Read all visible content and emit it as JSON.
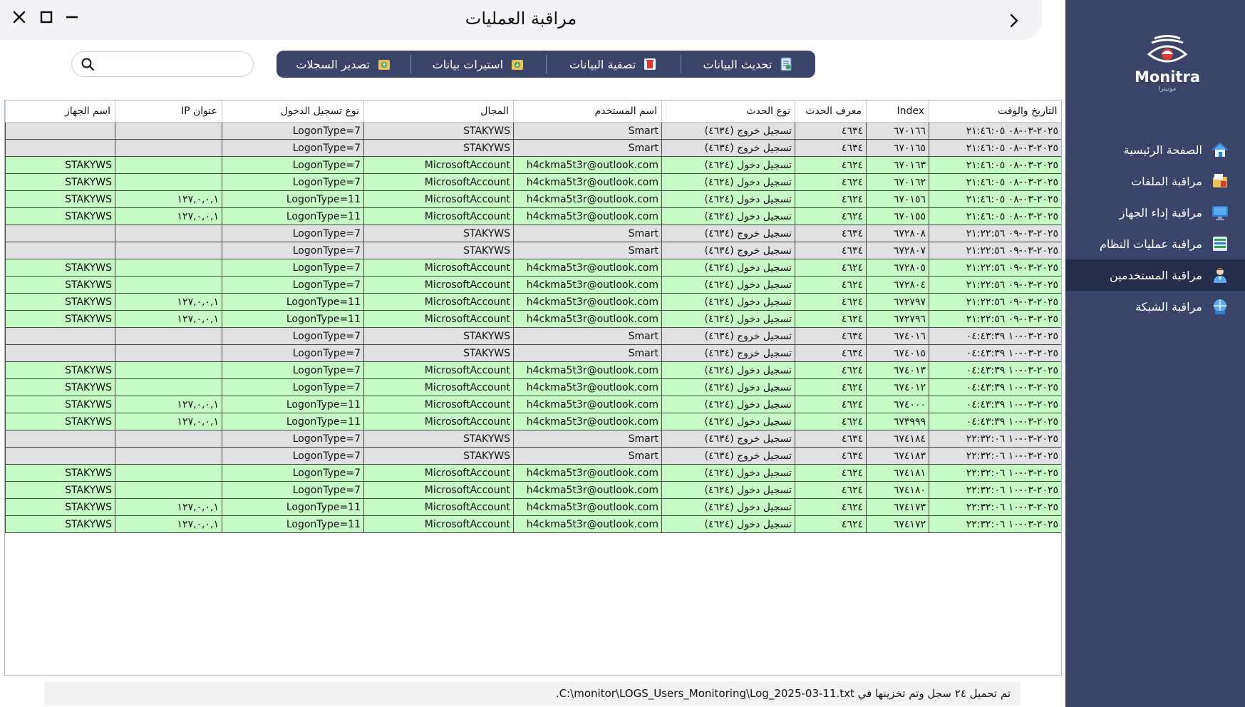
{
  "window": {
    "title": "مراقبة العمليات"
  },
  "search": {
    "placeholder": "",
    "value": ""
  },
  "toolbar": {
    "buttons": [
      {
        "label": "تحديث البيانات",
        "icon": "refresh-doc-icon"
      },
      {
        "label": "تصفية البيانات",
        "icon": "trash-icon"
      },
      {
        "label": "استيرات بيانات",
        "icon": "import-icon"
      },
      {
        "label": "تصدير السجلات",
        "icon": "export-icon"
      }
    ]
  },
  "table": {
    "headers": [
      "التاريخ والوقت",
      "Index",
      "معرف الحدث",
      "نوع الحدث",
      "اسم المستخدم",
      "المجال",
      "نوع تسجيل الدخول",
      "عنوان IP",
      "اسم الجهاز"
    ],
    "rows": [
      [
        "٢٠٢٥-٠٣-٠٨ ٢١:٤٦:٠٥",
        "٦٧٠١٦٦",
        "٤٦٣٤",
        "تسجيل خروج (٤٦٣٤)",
        "Smart",
        "STAKYWS",
        "LogonType=7",
        "",
        ""
      ],
      [
        "٢٠٢٥-٠٣-٠٨ ٢١:٤٦:٠٥",
        "٦٧٠١٦٥",
        "٤٦٣٤",
        "تسجيل خروج (٤٦٣٤)",
        "Smart",
        "STAKYWS",
        "LogonType=7",
        "",
        ""
      ],
      [
        "٢٠٢٥-٠٣-٠٨ ٢١:٤٦:٠٥",
        "٦٧٠١٦٣",
        "٤٦٢٤",
        "تسجيل دخول (٤٦٢٤)",
        "h4ckma5t3r@outlook.com",
        "MicrosoftAccount",
        "LogonType=7",
        "",
        "STAKYWS"
      ],
      [
        "٢٠٢٥-٠٣-٠٨ ٢١:٤٦:٠٥",
        "٦٧٠١٦٢",
        "٤٦٢٤",
        "تسجيل دخول (٤٦٢٤)",
        "h4ckma5t3r@outlook.com",
        "MicrosoftAccount",
        "LogonType=7",
        "",
        "STAKYWS"
      ],
      [
        "٢٠٢٥-٠٣-٠٨ ٢١:٤٦:٠٥",
        "٦٧٠١٥٦",
        "٤٦٢٤",
        "تسجيل دخول (٤٦٢٤)",
        "h4ckma5t3r@outlook.com",
        "MicrosoftAccount",
        "LogonType=11",
        "١٢٧,٠,٠,١",
        "STAKYWS"
      ],
      [
        "٢٠٢٥-٠٣-٠٨ ٢١:٤٦:٠٥",
        "٦٧٠١٥٥",
        "٤٦٢٤",
        "تسجيل دخول (٤٦٢٤)",
        "h4ckma5t3r@outlook.com",
        "MicrosoftAccount",
        "LogonType=11",
        "١٢٧,٠,٠,١",
        "STAKYWS"
      ],
      [
        "٢٠٢٥-٠٣-٠٩ ٢١:٢٢:٥٦",
        "٦٧٢٨٠٨",
        "٤٦٣٤",
        "تسجيل خروج (٤٦٣٤)",
        "Smart",
        "STAKYWS",
        "LogonType=7",
        "",
        ""
      ],
      [
        "٢٠٢٥-٠٣-٠٩ ٢١:٢٢:٥٦",
        "٦٧٢٨٠٧",
        "٤٦٣٤",
        "تسجيل خروج (٤٦٣٤)",
        "Smart",
        "STAKYWS",
        "LogonType=7",
        "",
        ""
      ],
      [
        "٢٠٢٥-٠٣-٠٩ ٢١:٢٢:٥٦",
        "٦٧٢٨٠٥",
        "٤٦٢٤",
        "تسجيل دخول (٤٦٢٤)",
        "h4ckma5t3r@outlook.com",
        "MicrosoftAccount",
        "LogonType=7",
        "",
        "STAKYWS"
      ],
      [
        "٢٠٢٥-٠٣-٠٩ ٢١:٢٢:٥٦",
        "٦٧٢٨٠٤",
        "٤٦٢٤",
        "تسجيل دخول (٤٦٢٤)",
        "h4ckma5t3r@outlook.com",
        "MicrosoftAccount",
        "LogonType=7",
        "",
        "STAKYWS"
      ],
      [
        "٢٠٢٥-٠٣-٠٩ ٢١:٢٢:٥٦",
        "٦٧٢٧٩٧",
        "٤٦٢٤",
        "تسجيل دخول (٤٦٢٤)",
        "h4ckma5t3r@outlook.com",
        "MicrosoftAccount",
        "LogonType=11",
        "١٢٧,٠,٠,١",
        "STAKYWS"
      ],
      [
        "٢٠٢٥-٠٣-٠٩ ٢١:٢٢:٥٦",
        "٦٧٢٧٩٦",
        "٤٦٢٤",
        "تسجيل دخول (٤٦٢٤)",
        "h4ckma5t3r@outlook.com",
        "MicrosoftAccount",
        "LogonType=11",
        "١٢٧,٠,٠,١",
        "STAKYWS"
      ],
      [
        "٢٠٢٥-٠٣-١٠ ٠٤:٤٣:٣٩",
        "٦٧٤٠١٦",
        "٤٦٣٤",
        "تسجيل خروج (٤٦٣٤)",
        "Smart",
        "STAKYWS",
        "LogonType=7",
        "",
        ""
      ],
      [
        "٢٠٢٥-٠٣-١٠ ٠٤:٤٣:٣٩",
        "٦٧٤٠١٥",
        "٤٦٣٤",
        "تسجيل خروج (٤٦٣٤)",
        "Smart",
        "STAKYWS",
        "LogonType=7",
        "",
        ""
      ],
      [
        "٢٠٢٥-٠٣-١٠ ٠٤:٤٣:٣٩",
        "٦٧٤٠١٣",
        "٤٦٢٤",
        "تسجيل دخول (٤٦٢٤)",
        "h4ckma5t3r@outlook.com",
        "MicrosoftAccount",
        "LogonType=7",
        "",
        "STAKYWS"
      ],
      [
        "٢٠٢٥-٠٣-١٠ ٠٤:٤٣:٣٩",
        "٦٧٤٠١٢",
        "٤٦٢٤",
        "تسجيل دخول (٤٦٢٤)",
        "h4ckma5t3r@outlook.com",
        "MicrosoftAccount",
        "LogonType=7",
        "",
        "STAKYWS"
      ],
      [
        "٢٠٢٥-٠٣-١٠ ٠٤:٤٣:٣٩",
        "٦٧٤٠٠٠",
        "٤٦٢٤",
        "تسجيل دخول (٤٦٢٤)",
        "h4ckma5t3r@outlook.com",
        "MicrosoftAccount",
        "LogonType=11",
        "١٢٧,٠,٠,١",
        "STAKYWS"
      ],
      [
        "٢٠٢٥-٠٣-١٠ ٠٤:٤٣:٣٩",
        "٦٧٣٩٩٩",
        "٤٦٢٤",
        "تسجيل دخول (٤٦٢٤)",
        "h4ckma5t3r@outlook.com",
        "MicrosoftAccount",
        "LogonType=11",
        "١٢٧,٠,٠,١",
        "STAKYWS"
      ],
      [
        "٢٠٢٥-٠٣-١٠ ٢٢:٣٢:٠٦",
        "٦٧٤١٨٤",
        "٤٦٣٤",
        "تسجيل خروج (٤٦٣٤)",
        "Smart",
        "STAKYWS",
        "LogonType=7",
        "",
        ""
      ],
      [
        "٢٠٢٥-٠٣-١٠ ٢٢:٣٢:٠٦",
        "٦٧٤١٨٣",
        "٤٦٣٤",
        "تسجيل خروج (٤٦٣٤)",
        "Smart",
        "STAKYWS",
        "LogonType=7",
        "",
        ""
      ],
      [
        "٢٠٢٥-٠٣-١٠ ٢٢:٣٢:٠٦",
        "٦٧٤١٨١",
        "٤٦٢٤",
        "تسجيل دخول (٤٦٢٤)",
        "h4ckma5t3r@outlook.com",
        "MicrosoftAccount",
        "LogonType=7",
        "",
        "STAKYWS"
      ],
      [
        "٢٠٢٥-٠٣-١٠ ٢٢:٣٢:٠٦",
        "٦٧٤١٨٠",
        "٤٦٢٤",
        "تسجيل دخول (٤٦٢٤)",
        "h4ckma5t3r@outlook.com",
        "MicrosoftAccount",
        "LogonType=7",
        "",
        "STAKYWS"
      ],
      [
        "٢٠٢٥-٠٣-١٠ ٢٢:٣٢:٠٦",
        "٦٧٤١٧٣",
        "٤٦٢٤",
        "تسجيل دخول (٤٦٢٤)",
        "h4ckma5t3r@outlook.com",
        "MicrosoftAccount",
        "LogonType=11",
        "١٢٧,٠,٠,١",
        "STAKYWS"
      ],
      [
        "٢٠٢٥-٠٣-١٠ ٢٢:٣٢:٠٦",
        "٦٧٤١٧٢",
        "٤٦٢٤",
        "تسجيل دخول (٤٦٢٤)",
        "h4ckma5t3r@outlook.com",
        "MicrosoftAccount",
        "LogonType=11",
        "١٢٧,٠,٠,١",
        "STAKYWS"
      ]
    ]
  },
  "status_bar": {
    "text": "تم تحميل ٢٤ سجل وتم تخزينها في C:\\monitor\\LOGS_Users_Monitoring\\Log_2025-03-11.txt."
  },
  "sidebar": {
    "logo_text": "Monitra",
    "logo_sub": "مونيترا",
    "items": [
      {
        "label": "الصفحة الرئيسية",
        "icon": "home-icon",
        "active": false
      },
      {
        "label": "مراقبة الملفات",
        "icon": "folder-icon",
        "active": false
      },
      {
        "label": "مراقبة إداء الجهاز",
        "icon": "monitor-icon",
        "active": false
      },
      {
        "label": "مراقبة عمليات النظام",
        "icon": "server-icon",
        "active": false
      },
      {
        "label": "مراقبة المستخدمين",
        "icon": "user-icon",
        "active": true
      },
      {
        "label": "مراقبة الشبكة",
        "icon": "network-icon",
        "active": false
      }
    ]
  },
  "colors": {
    "sidebar_bg": "#3a4468",
    "sidebar_active": "#252d4b",
    "logon_row": "#c7fbc5",
    "logout_row": "#e1e1e1"
  }
}
